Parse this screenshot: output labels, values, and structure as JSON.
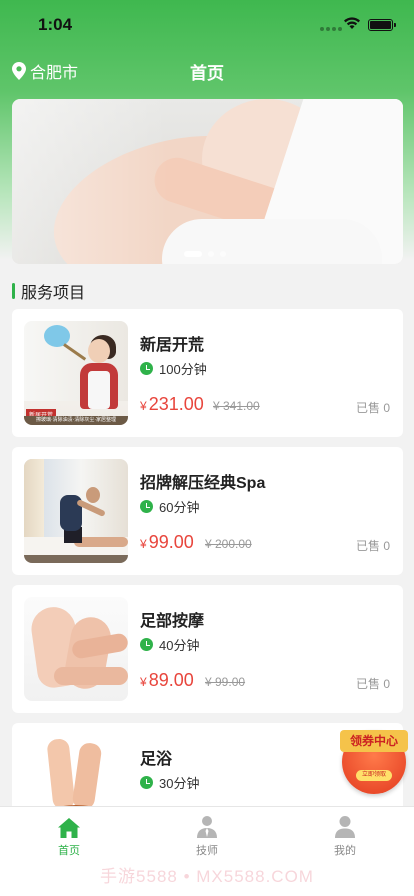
{
  "status": {
    "time": "1:04"
  },
  "nav": {
    "city": "合肥市",
    "title": "首页"
  },
  "banner": {
    "indicator_count": 3,
    "active_index": 0
  },
  "section": {
    "title": "服务项目"
  },
  "services": [
    {
      "name": "新居开荒",
      "duration": "100分钟",
      "currency": "¥",
      "price": "231.00",
      "original": "¥ 341.00",
      "sold": "已售 0",
      "thumb_tag": "新居开荒",
      "thumb_strip": "擦玻璃·清除油渍·清除灰尘·家居整理"
    },
    {
      "name": "招牌解压经典Spa",
      "duration": "60分钟",
      "currency": "¥",
      "price": "99.00",
      "original": "¥ 200.00",
      "sold": "已售 0"
    },
    {
      "name": "足部按摩",
      "duration": "40分钟",
      "currency": "¥",
      "price": "89.00",
      "original": "¥ 99.00",
      "sold": "已售 0"
    },
    {
      "name": "足浴",
      "duration": "30分钟"
    }
  ],
  "coupon": {
    "label": "领券中心",
    "button": "立即领取"
  },
  "tabbar": [
    {
      "label": "首页",
      "active": true
    },
    {
      "label": "技师",
      "active": false
    },
    {
      "label": "我的",
      "active": false
    }
  ],
  "watermark": "手游5588 • MX5588.COM",
  "colors": {
    "brand_green": "#2fb24a",
    "price_red": "#e8453c"
  }
}
